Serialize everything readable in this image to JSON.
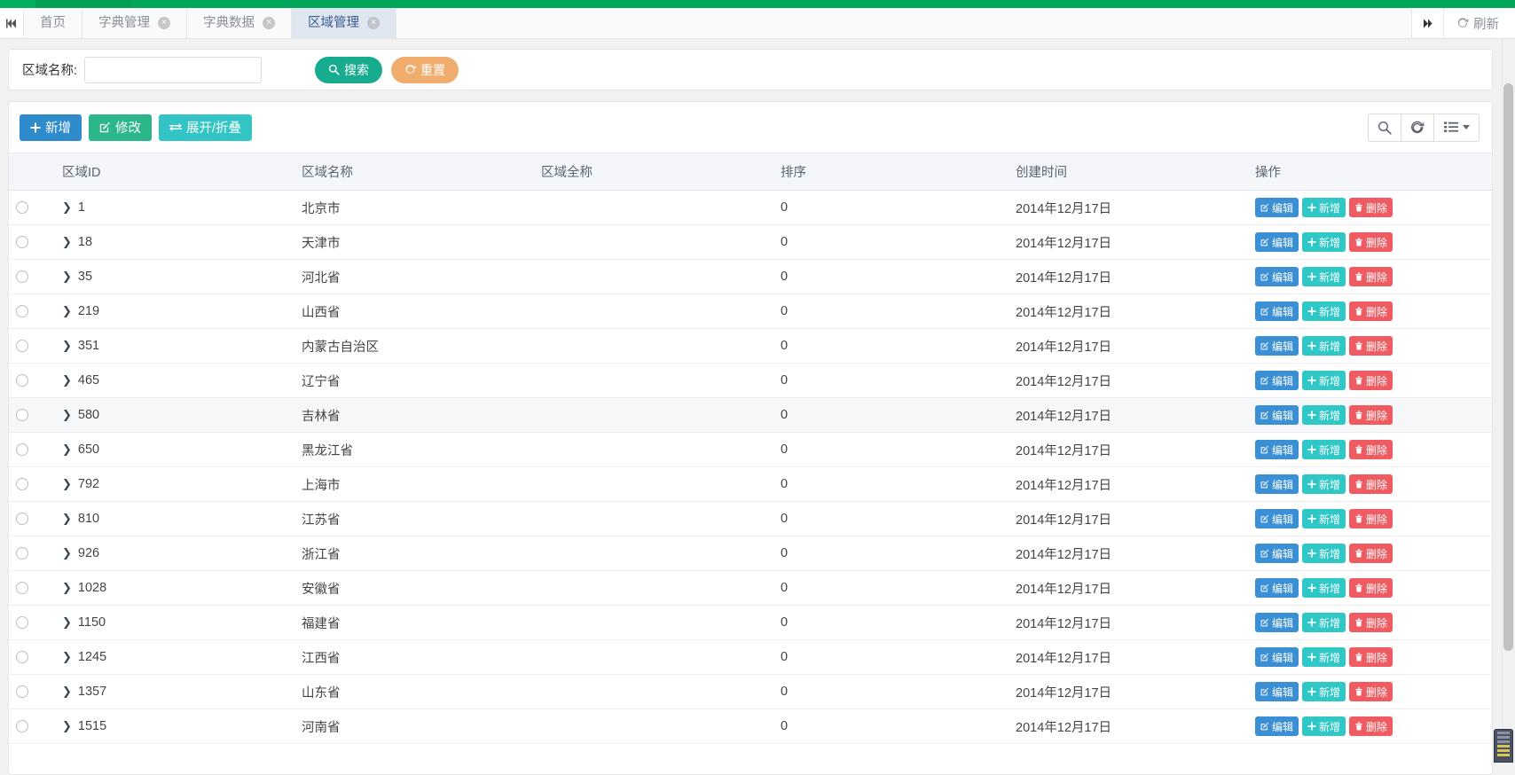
{
  "tabbar": {
    "nav_prev_icon": "chevron-double-left-icon",
    "nav_next_icon": "chevron-double-right-icon",
    "refresh_label": "刷新",
    "refresh_icon": "refresh-icon",
    "close_glyph": "×",
    "tabs": [
      {
        "label": "首页",
        "closable": false,
        "active": false
      },
      {
        "label": "字典管理",
        "closable": true,
        "active": false
      },
      {
        "label": "字典数据",
        "closable": true,
        "active": false
      },
      {
        "label": "区域管理",
        "closable": true,
        "active": true
      }
    ]
  },
  "search": {
    "label": "区域名称:",
    "value": "",
    "placeholder": "",
    "search_button": "搜索",
    "search_icon": "search-icon",
    "reset_button": "重置",
    "reset_icon": "refresh-icon"
  },
  "toolbar": {
    "add_label": "新增",
    "add_icon": "plus-icon",
    "edit_label": "修改",
    "edit_icon": "pencil-square-icon",
    "expand_label": "展开/折叠",
    "expand_icon": "exchange-icon",
    "search_icon": "search-icon",
    "refresh_icon": "refresh-icon",
    "columns_icon": "list-icon"
  },
  "table": {
    "columns": [
      "区域ID",
      "区域名称",
      "区域全称",
      "排序",
      "创建时间",
      "操作"
    ],
    "row_actions": {
      "edit_label": "编辑",
      "edit_icon": "pencil-square-icon",
      "add_label": "新增",
      "add_icon": "plus-icon",
      "delete_label": "删除",
      "delete_icon": "trash-icon"
    },
    "expander_glyph": "❯",
    "rows": [
      {
        "id": "1",
        "name": "北京市",
        "full": "",
        "sort": "0",
        "time": "2014年12月17日",
        "hovered": false
      },
      {
        "id": "18",
        "name": "天津市",
        "full": "",
        "sort": "0",
        "time": "2014年12月17日",
        "hovered": false
      },
      {
        "id": "35",
        "name": "河北省",
        "full": "",
        "sort": "0",
        "time": "2014年12月17日",
        "hovered": false
      },
      {
        "id": "219",
        "name": "山西省",
        "full": "",
        "sort": "0",
        "time": "2014年12月17日",
        "hovered": false
      },
      {
        "id": "351",
        "name": "内蒙古自治区",
        "full": "",
        "sort": "0",
        "time": "2014年12月17日",
        "hovered": false
      },
      {
        "id": "465",
        "name": "辽宁省",
        "full": "",
        "sort": "0",
        "time": "2014年12月17日",
        "hovered": false
      },
      {
        "id": "580",
        "name": "吉林省",
        "full": "",
        "sort": "0",
        "time": "2014年12月17日",
        "hovered": true
      },
      {
        "id": "650",
        "name": "黑龙江省",
        "full": "",
        "sort": "0",
        "time": "2014年12月17日",
        "hovered": false
      },
      {
        "id": "792",
        "name": "上海市",
        "full": "",
        "sort": "0",
        "time": "2014年12月17日",
        "hovered": false
      },
      {
        "id": "810",
        "name": "江苏省",
        "full": "",
        "sort": "0",
        "time": "2014年12月17日",
        "hovered": false
      },
      {
        "id": "926",
        "name": "浙江省",
        "full": "",
        "sort": "0",
        "time": "2014年12月17日",
        "hovered": false
      },
      {
        "id": "1028",
        "name": "安徽省",
        "full": "",
        "sort": "0",
        "time": "2014年12月17日",
        "hovered": false
      },
      {
        "id": "1150",
        "name": "福建省",
        "full": "",
        "sort": "0",
        "time": "2014年12月17日",
        "hovered": false
      },
      {
        "id": "1245",
        "name": "江西省",
        "full": "",
        "sort": "0",
        "time": "2014年12月17日",
        "hovered": false
      },
      {
        "id": "1357",
        "name": "山东省",
        "full": "",
        "sort": "0",
        "time": "2014年12月17日",
        "hovered": false
      },
      {
        "id": "1515",
        "name": "河南省",
        "full": "",
        "sort": "0",
        "time": "2014年12月17日",
        "hovered": false
      }
    ]
  },
  "colors": {
    "brand_green": "#00a65a",
    "search_btn": "#18ac8e",
    "reset_btn": "#f0ad6e",
    "add_btn": "#2e8bcc",
    "edit_btn": "#2bb789",
    "expand_btn": "#33c5c5",
    "row_edit_btn": "#3b8fd4",
    "row_add_btn": "#30c7c7",
    "row_delete_btn": "#ef5b61",
    "active_tab_bg": "#dfe6f0"
  }
}
